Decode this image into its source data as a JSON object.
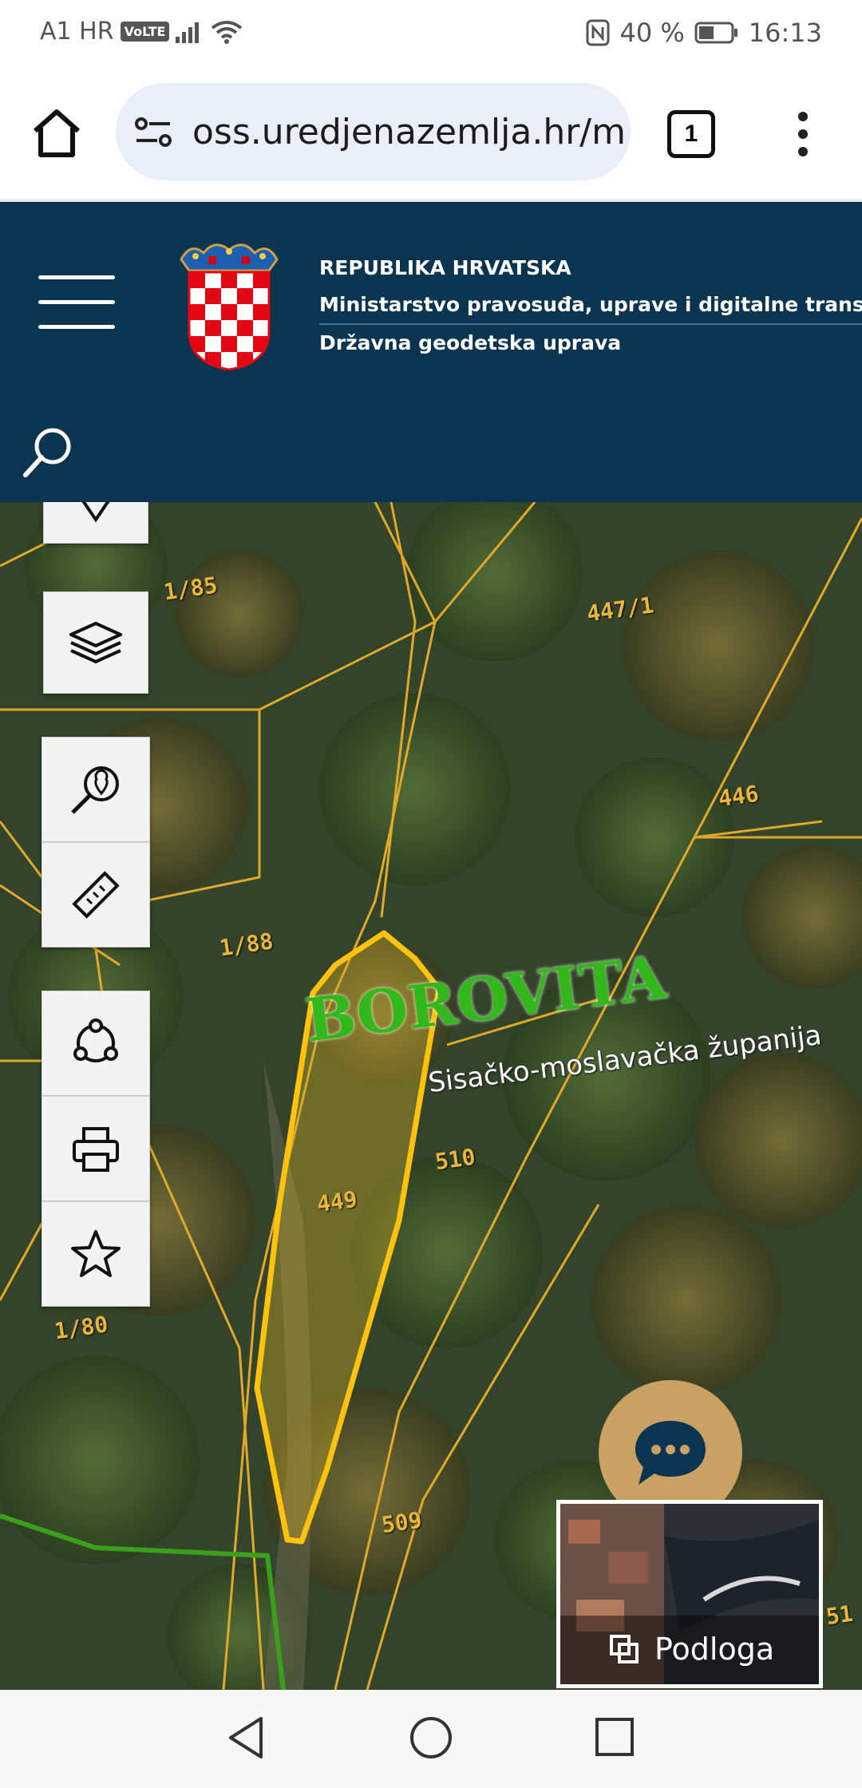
{
  "status_bar": {
    "carrier": "A1 HR",
    "volte": "VoLTE",
    "battery": "40 %",
    "time": "16:13"
  },
  "browser": {
    "url": "oss.uredjenazemlja.hr/m",
    "tab_count": "1"
  },
  "site_header": {
    "line1": "REPUBLIKA HRVATSKA",
    "line2": "Ministarstvo pravosuđa, uprave i digitalne transformacije",
    "line3": "Državna geodetska uprava",
    "colors": {
      "background": "#0b3450"
    }
  },
  "map": {
    "toolbar_icons": [
      "location-pin-icon",
      "layers-icon",
      "search-location-icon",
      "ruler-icon",
      "polygon-icon",
      "print-icon",
      "star-icon"
    ],
    "place_name": "BOROVITA",
    "county_label": "Sisačko-moslavačka županija",
    "parcel_labels": [
      "1/85",
      "447/1",
      "446",
      "1/88",
      "449",
      "510",
      "1/80",
      "509",
      "51"
    ],
    "basemap_label": "Podloga",
    "colors": {
      "parcel_lines": "#e0a92c",
      "selected_parcel": "#ffc20e",
      "boundary": "#3aa01c",
      "chat_button": "#c9a163"
    }
  }
}
